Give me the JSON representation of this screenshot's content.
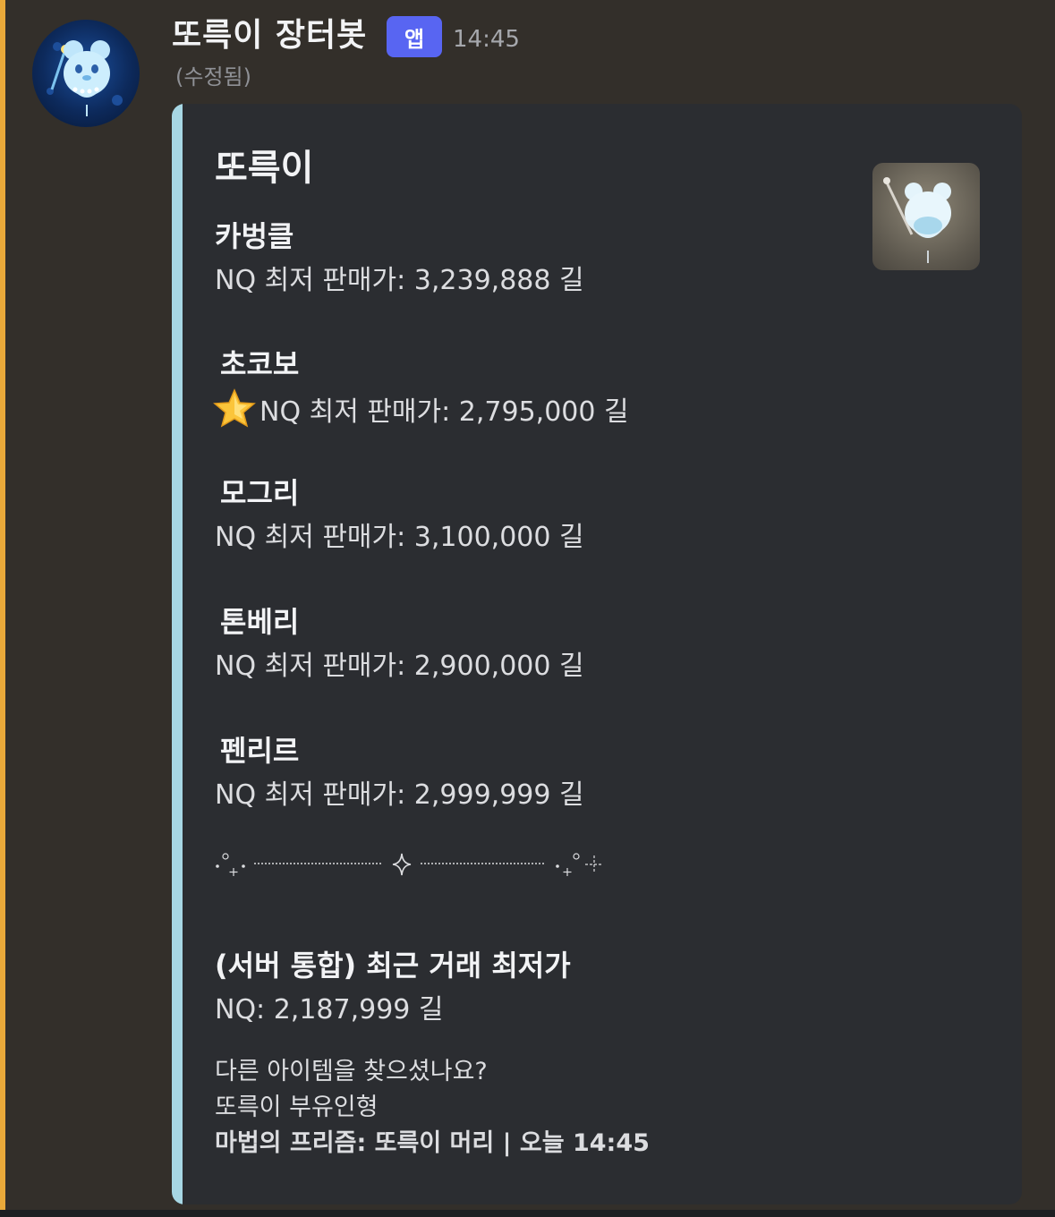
{
  "message": {
    "username": "또륵이 장터봇",
    "badge": "앱",
    "timestamp": "14:45",
    "edited": "(수정됨)",
    "avatar_icon": "ghost-mouse-avatar-icon"
  },
  "embed": {
    "accent_color": "#a7d7e4",
    "thumbnail_icon": "mouse-balloon-thumbnail-icon",
    "title": "또륵이",
    "fields": [
      {
        "name": "카벙클",
        "value": "NQ 최저 판매가: 3,239,888 길"
      },
      {
        "name": "초코보",
        "value": "NQ 최저 판매가: 2,795,000 길",
        "icon": "star-icon"
      },
      {
        "name": "모그리",
        "value": "NQ 최저 판매가: 3,100,000 길"
      },
      {
        "name": "톤베리",
        "value": "NQ 최저 판매가: 2,900,000 길"
      },
      {
        "name": "펜리르",
        "value": "NQ 최저 판매가: 2,999,999 길"
      }
    ],
    "divider_icon": "sparkle-divider",
    "recent": {
      "name": "(서버 통합) 최근 거래 최저가",
      "value": "NQ: 2,187,999 길"
    },
    "footer": {
      "question": "다른 아이템을 찾으셨나요?",
      "suggestion": "또륵이 부유인형",
      "source": "마법의 프리즘: 또륵이 머리 | 오늘 14:45"
    }
  }
}
